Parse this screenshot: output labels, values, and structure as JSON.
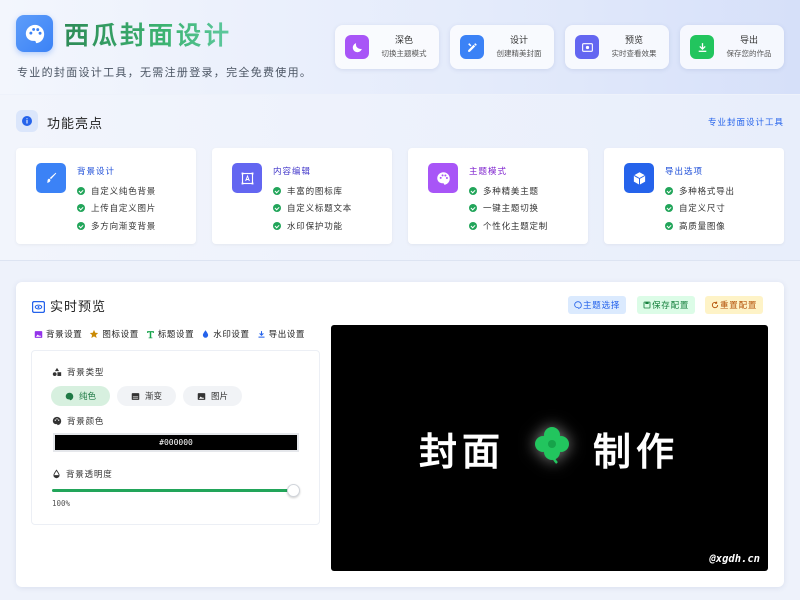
{
  "header": {
    "title": "西瓜封面设计",
    "tagline": "专业的封面设计工具，无需注册登录，完全免费使用。",
    "buttons": [
      {
        "label": "深色",
        "sub": "切换主题模式",
        "icon": "moon-icon",
        "color": "#a855f7"
      },
      {
        "label": "设计",
        "sub": "创建精美封面",
        "icon": "design-tools-icon",
        "color": "#3b82f6"
      },
      {
        "label": "预览",
        "sub": "实时查看效果",
        "icon": "preview-icon",
        "color": "#6366f1"
      },
      {
        "label": "导出",
        "sub": "保存您的作品",
        "icon": "download-icon",
        "color": "#22c55e"
      }
    ]
  },
  "highlights": {
    "title": "功能亮点",
    "link": "专业封面设计工具",
    "cards": [
      {
        "title": "背景设计",
        "title_color": "#1d4ed8",
        "icon": "brush-icon",
        "icon_color": "#3b82f6",
        "items": [
          "自定义纯色背景",
          "上传自定义图片",
          "多方向渐变背景"
        ]
      },
      {
        "title": "内容编辑",
        "title_color": "#4338ca",
        "icon": "text-edit-icon",
        "icon_color": "#6366f1",
        "items": [
          "丰富的图标库",
          "自定义标题文本",
          "水印保护功能"
        ]
      },
      {
        "title": "主题模式",
        "title_color": "#7e22ce",
        "icon": "palette-icon",
        "icon_color": "#a855f7",
        "items": [
          "多种精美主题",
          "一键主题切换",
          "个性化主题定制"
        ]
      },
      {
        "title": "导出选项",
        "title_color": "#1d4ed8",
        "icon": "cube-icon",
        "icon_color": "#2563eb",
        "items": [
          "多种格式导出",
          "自定义尺寸",
          "高质量图像"
        ]
      }
    ]
  },
  "preview": {
    "title": "实时预览",
    "actions": [
      {
        "label": "主题选择",
        "icon": "palette-icon",
        "bg": "#dbeafe",
        "fg": "#2563eb"
      },
      {
        "label": "保存配置",
        "icon": "save-icon",
        "bg": "#dcfce7",
        "fg": "#15803d"
      },
      {
        "label": "重置配置",
        "icon": "reset-icon",
        "bg": "#fef3c7",
        "fg": "#b45309"
      }
    ],
    "tabs": [
      {
        "label": "背景设置",
        "icon": "image-icon"
      },
      {
        "label": "图标设置",
        "icon": "star-icon"
      },
      {
        "label": "标题设置",
        "icon": "text-icon"
      },
      {
        "label": "水印设置",
        "icon": "droplet-icon"
      },
      {
        "label": "导出设置",
        "icon": "download-icon"
      }
    ],
    "settings": {
      "bg_type_label": "背景类型",
      "bg_types": [
        {
          "label": "纯色",
          "active": true
        },
        {
          "label": "渐变",
          "active": false
        },
        {
          "label": "图片",
          "active": false
        }
      ],
      "bg_color_label": "背景颜色",
      "bg_color_value": "#000000",
      "opacity_label": "背景透明度",
      "opacity_value": "100%",
      "opacity_fraction": 1.0
    },
    "canvas": {
      "background": "#000000",
      "title_left": "封面",
      "title_right": "制作",
      "icon": "clover-icon",
      "icon_color": "#22c55e",
      "watermark": "@xgdh.cn"
    }
  }
}
